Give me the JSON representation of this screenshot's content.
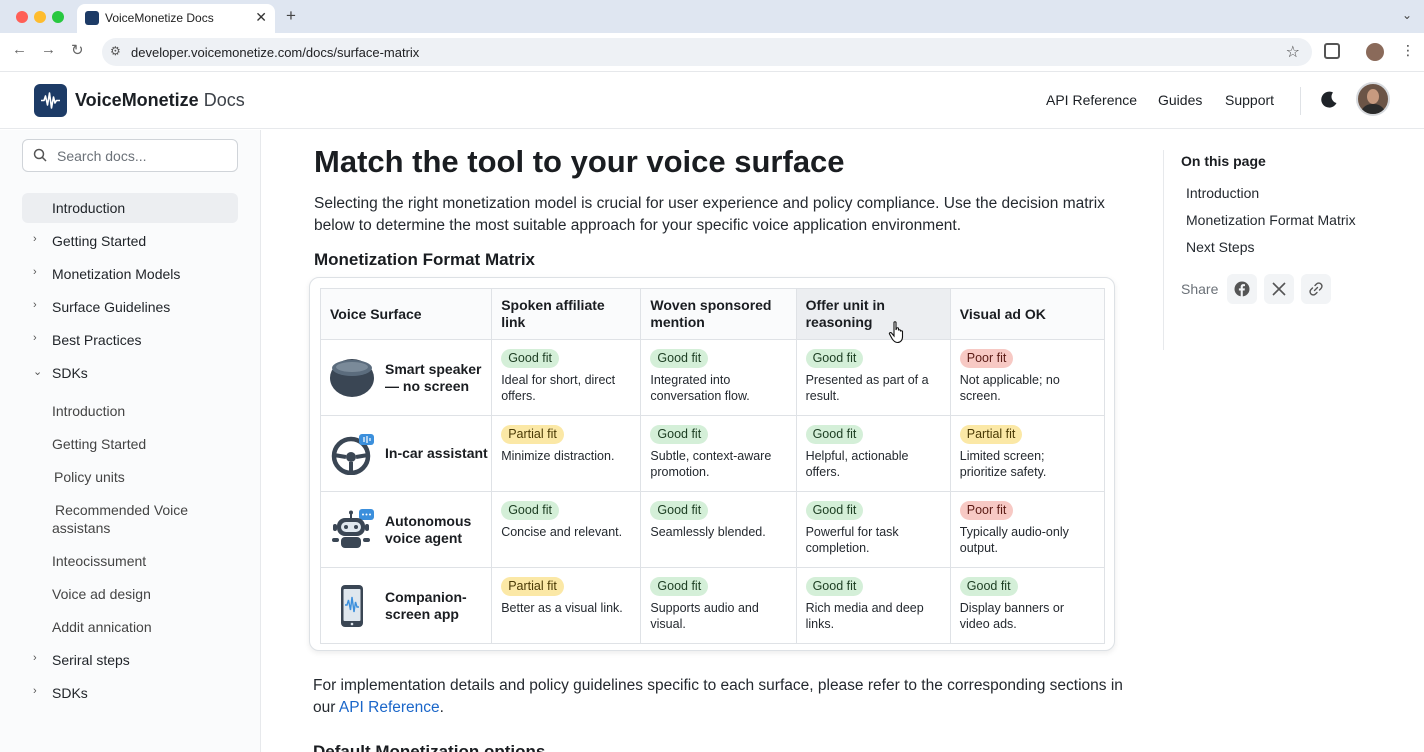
{
  "browser": {
    "tab_title": "VoiceMonetize Docs",
    "url": "developer.voicemonetize.com/docs/surface-matrix"
  },
  "header": {
    "brand_name": "VoiceMonetize",
    "brand_suffix": "Docs",
    "nav": [
      "API Reference",
      "Guides",
      "Support"
    ]
  },
  "sidebar": {
    "search_placeholder": "Search docs...",
    "items": [
      {
        "label": "Introduction",
        "active": true
      },
      {
        "label": "Getting Started",
        "chevron": "right"
      },
      {
        "label": "Monetization Models",
        "chevron": "right"
      },
      {
        "label": "Surface Guidelines",
        "chevron": "right"
      },
      {
        "label": "Best Practices",
        "chevron": "right"
      },
      {
        "label": "SDKs",
        "chevron": "down"
      }
    ],
    "sub_items": [
      "Introduction",
      "Getting Started",
      "Policy units",
      "Recommended Voice assistans",
      "Inteocissument",
      "Voice ad design",
      "Addit annication"
    ],
    "bottom_items": [
      {
        "label": "Seriral steps",
        "chevron": "right"
      },
      {
        "label": "SDKs",
        "chevron": "right"
      }
    ]
  },
  "main": {
    "title": "Match the tool to your voice surface",
    "intro": "Selecting the right monetization model is crucial for user experience and policy compliance. Use the decision matrix below to determine the most suitable approach for your specific voice application environment.",
    "matrix_heading": "Monetization Format Matrix",
    "footer_text_before_link": "For implementation details and policy guidelines specific to each surface, please refer to the corresponding sections in our ",
    "footer_link": "API Reference",
    "footer_text_after_link": ".",
    "next_heading": "Default Monetization options"
  },
  "matrix": {
    "headers": [
      "Voice Surface",
      "Spoken affiliate link",
      "Woven sponsored mention",
      "Offer unit in reasoning",
      "Visual ad OK"
    ],
    "rows": [
      {
        "surface": "Smart speaker — no screen",
        "icon": "smart-speaker-icon",
        "cells": [
          {
            "fit": "Good fit",
            "level": "good",
            "desc": "Ideal for short, direct offers."
          },
          {
            "fit": "Good fit",
            "level": "good",
            "desc": "Integrated into conversation flow."
          },
          {
            "fit": "Good fit",
            "level": "good",
            "desc": "Presented as part of a result."
          },
          {
            "fit": "Poor fit",
            "level": "poor",
            "desc": "Not applicable; no screen."
          }
        ]
      },
      {
        "surface": "In-car assistant",
        "icon": "steering-wheel-icon",
        "cells": [
          {
            "fit": "Partial fit",
            "level": "partial",
            "desc": "Minimize distraction."
          },
          {
            "fit": "Good fit",
            "level": "good",
            "desc": "Subtle, context-aware promotion."
          },
          {
            "fit": "Good fit",
            "level": "good",
            "desc": "Helpful, actionable offers."
          },
          {
            "fit": "Partial fit",
            "level": "partial",
            "desc": "Limited screen; prioritize safety."
          }
        ]
      },
      {
        "surface": "Autonomous voice agent",
        "icon": "robot-icon",
        "cells": [
          {
            "fit": "Good fit",
            "level": "good",
            "desc": "Concise and relevant."
          },
          {
            "fit": "Good fit",
            "level": "good",
            "desc": "Seamlessly blended."
          },
          {
            "fit": "Good fit",
            "level": "good",
            "desc": "Powerful for task completion."
          },
          {
            "fit": "Poor fit",
            "level": "poor",
            "desc": "Typically audio-only output."
          }
        ]
      },
      {
        "surface": "Companion-screen app",
        "icon": "smartphone-icon",
        "cells": [
          {
            "fit": "Partial fit",
            "level": "partial",
            "desc": "Better as a visual link."
          },
          {
            "fit": "Good fit",
            "level": "good",
            "desc": "Supports audio and visual."
          },
          {
            "fit": "Good fit",
            "level": "good",
            "desc": "Rich media and deep links."
          },
          {
            "fit": "Good fit",
            "level": "good",
            "desc": "Display banners or video ads."
          }
        ]
      }
    ]
  },
  "toc": {
    "title": "On this page",
    "items": [
      "Introduction",
      "Monetization Format Matrix",
      "Next Steps"
    ],
    "share_label": "Share"
  },
  "colors": {
    "brand": "#1d3b66",
    "good": "#d4efd8",
    "partial": "#fbe8a6",
    "poor": "#f7c9c4",
    "link": "#1a66c9"
  }
}
